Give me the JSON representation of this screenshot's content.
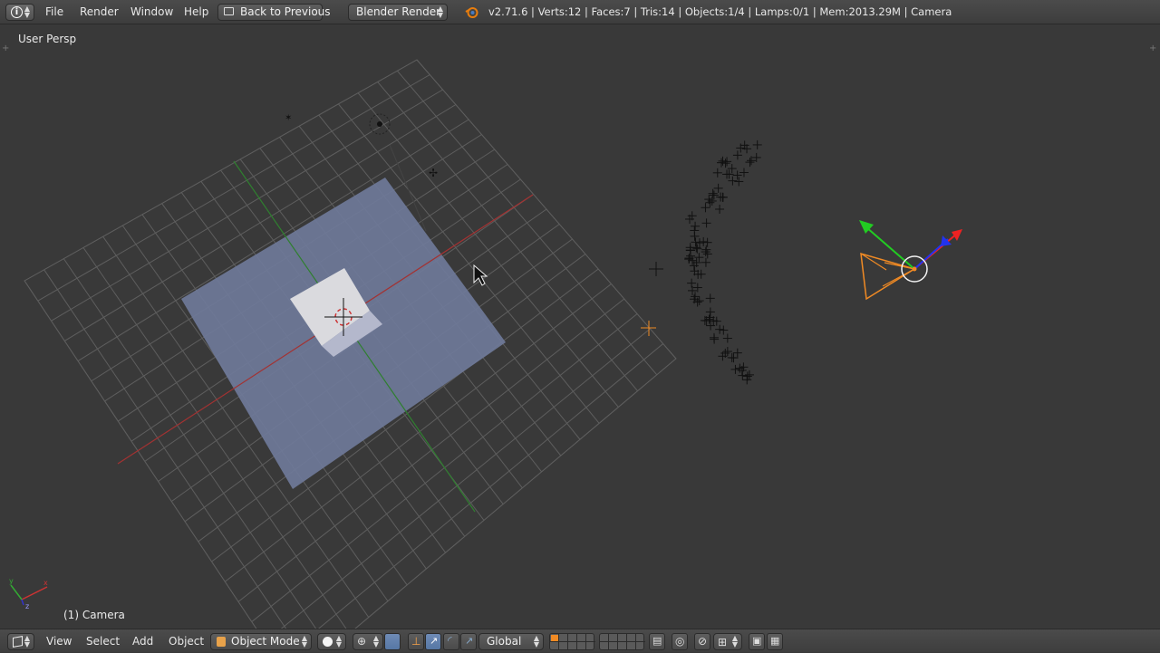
{
  "header": {
    "menus": [
      "File",
      "Render",
      "Window",
      "Help"
    ],
    "back_label": "Back to Previous",
    "engine": "Blender Render",
    "stats": "v2.71.6 | Verts:12 | Faces:7 | Tris:14 | Objects:1/4 | Lamps:0/1 | Mem:2013.29M | Camera"
  },
  "viewport": {
    "view_name": "User Persp",
    "active_object": "(1) Camera"
  },
  "footer": {
    "menus": [
      "View",
      "Select",
      "Add",
      "Object"
    ],
    "mode": "Object Mode",
    "orientation": "Global"
  },
  "colors": {
    "background": "#393939",
    "grid": "#5c5c5c",
    "x_axis": "#b03030",
    "y_axis": "#2e8a2e",
    "plane": "#6f7a99",
    "cube": "#d8d8dc",
    "selection": "#f08a24",
    "gizmo_x": "#ee2222",
    "gizmo_y": "#22cc22",
    "gizmo_z": "#2233ee"
  }
}
